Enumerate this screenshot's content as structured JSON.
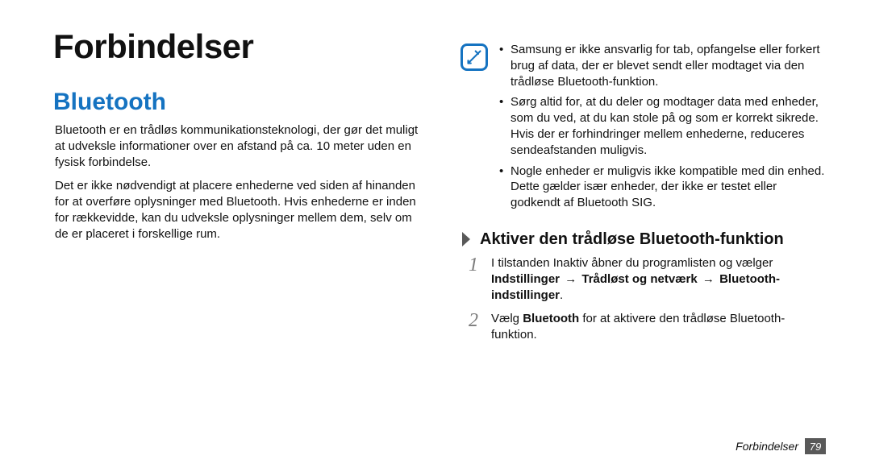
{
  "page": {
    "title": "Forbindelser",
    "footer_title": "Forbindelser",
    "footer_page": "79"
  },
  "left": {
    "section_title": "Bluetooth",
    "p1": "Bluetooth er en trådløs kommunikationsteknologi, der gør det muligt at udveksle informationer over en afstand på ca. 10 meter uden en fysisk forbindelse.",
    "p2": "Det er ikke nødvendigt at placere enhederne ved siden af hinanden for at overføre oplysninger med Bluetooth. Hvis enhederne er inden for rækkevidde, kan du udveksle oplysninger mellem dem, selv om de er placeret i forskellige rum."
  },
  "right": {
    "note_items": [
      "Samsung er ikke ansvarlig for tab, opfangelse eller forkert brug af data, der er blevet sendt eller modtaget via den trådløse Bluetooth-funktion.",
      "Sørg altid for, at du deler og modtager data med enheder, som du ved, at du kan stole på og som er korrekt sikrede. Hvis der er forhindringer mellem enhederne, reduceres sendeafstanden muligvis.",
      "Nogle enheder er muligvis ikke kompatible med din enhed. Dette gælder især enheder, der ikke er testet eller godkendt af Bluetooth SIG."
    ],
    "subheading": "Aktiver den trådløse Bluetooth-funktion",
    "steps": {
      "s1_num": "1",
      "s1_lead": "I tilstanden Inaktiv åbner du programlisten og vælger ",
      "s1_path_1": "Indstillinger",
      "s1_path_2": "Trådløst og netværk",
      "s1_path_3": "Bluetooth-indstillinger",
      "s1_period": ".",
      "s2_num": "2",
      "s2_part1": "Vælg ",
      "s2_bold": "Bluetooth",
      "s2_part2": " for at aktivere den trådløse Bluetooth-funktion."
    }
  },
  "icons": {
    "note": "note-icon",
    "chevron": "chevron-right-icon"
  }
}
